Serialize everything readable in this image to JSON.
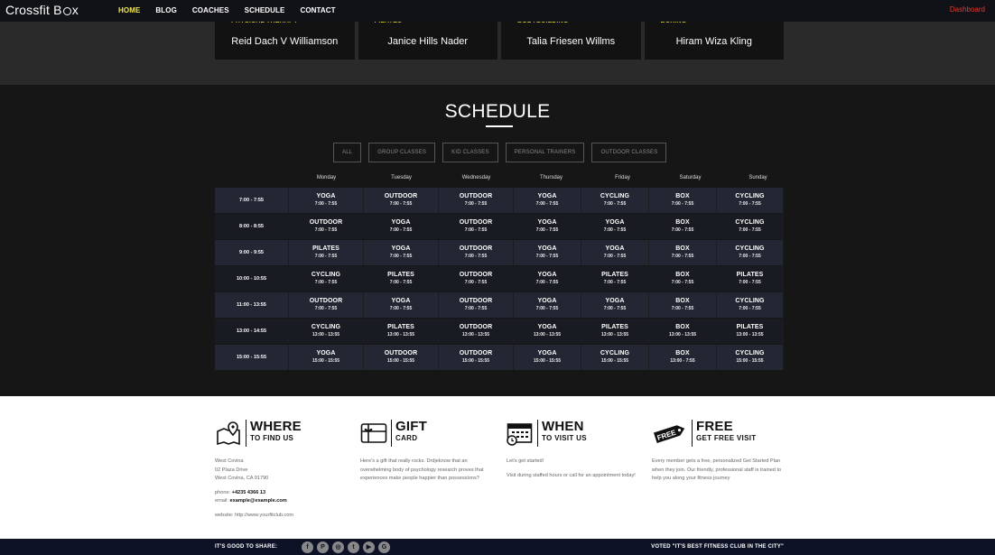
{
  "nav": {
    "logo": "Crossfit B",
    "logo_end": "x",
    "links": [
      "HOME",
      "BLOG",
      "COACHES",
      "SCHEDULE",
      "CONTACT"
    ],
    "dashboard": "Dashboard"
  },
  "coaches": [
    {
      "role": "PHYSICAL THERAPY",
      "name": "Reid Dach V Williamson"
    },
    {
      "role": "PILATES",
      "name": "Janice Hills Nader"
    },
    {
      "role": "BODYBUILDING",
      "name": "Talia Friesen Willms"
    },
    {
      "role": "BOXING",
      "name": "Hiram Wiza Kling"
    }
  ],
  "schedule": {
    "title": "SCHEDULE",
    "filters": [
      "ALL",
      "GROUP CLASSES",
      "KID CLASSES",
      "PERSONAL TRAINERS",
      "OUTDOOR CLASSES"
    ],
    "days": [
      "Monday",
      "Tuesday",
      "Wednesday",
      "Thursday",
      "Friday",
      "Saturday",
      "Sunday"
    ],
    "rows": [
      {
        "time": "7:00 - 7:55",
        "slots": [
          {
            "cls": "YOGA",
            "tm": "7:00 - 7:55"
          },
          {
            "cls": "OUTDOOR",
            "tm": "7:00 - 7:55"
          },
          {
            "cls": "OUTDOOR",
            "tm": "7:00 - 7:55"
          },
          {
            "cls": "YOGA",
            "tm": "7:00 - 7:55"
          },
          {
            "cls": "CYCLING",
            "tm": "7:00 - 7:55"
          },
          {
            "cls": "BOX",
            "tm": "7:00 - 7:55"
          },
          {
            "cls": "CYCLING",
            "tm": "7:00 - 7:55"
          }
        ]
      },
      {
        "time": "8:00 - 8:55",
        "slots": [
          {
            "cls": "OUTDOOR",
            "tm": "7:00 - 7:55"
          },
          {
            "cls": "YOGA",
            "tm": "7:00 - 7:55"
          },
          {
            "cls": "OUTDOOR",
            "tm": "7:00 - 7:55"
          },
          {
            "cls": "YOGA",
            "tm": "7:00 - 7:55"
          },
          {
            "cls": "YOGA",
            "tm": "7:00 - 7:55"
          },
          {
            "cls": "BOX",
            "tm": "7:00 - 7:55"
          },
          {
            "cls": "CYCLING",
            "tm": "7:00 - 7:55"
          }
        ]
      },
      {
        "time": "9:00 - 9:55",
        "slots": [
          {
            "cls": "PILATES",
            "tm": "7:00 - 7:55"
          },
          {
            "cls": "YOGA",
            "tm": "7:00 - 7:55"
          },
          {
            "cls": "OUTDOOR",
            "tm": "7:00 - 7:55"
          },
          {
            "cls": "YOGA",
            "tm": "7:00 - 7:55"
          },
          {
            "cls": "YOGA",
            "tm": "7:00 - 7:55"
          },
          {
            "cls": "BOX",
            "tm": "7:00 - 7:55"
          },
          {
            "cls": "CYCLING",
            "tm": "7:00 - 7:55"
          }
        ]
      },
      {
        "time": "10:00 - 10:55",
        "slots": [
          {
            "cls": "CYCLING",
            "tm": "7:00 - 7:55"
          },
          {
            "cls": "PILATES",
            "tm": "7:00 - 7:55"
          },
          {
            "cls": "OUTDOOR",
            "tm": "7:00 - 7:55"
          },
          {
            "cls": "YOGA",
            "tm": "7:00 - 7:55"
          },
          {
            "cls": "PILATES",
            "tm": "7:00 - 7:55"
          },
          {
            "cls": "BOX",
            "tm": "7:00 - 7:55"
          },
          {
            "cls": "PILATES",
            "tm": "7:00 - 7:55"
          }
        ]
      },
      {
        "time": "11:00 - 13:55",
        "slots": [
          {
            "cls": "OUTDOOR",
            "tm": "7:00 - 7:55"
          },
          {
            "cls": "YOGA",
            "tm": "7:00 - 7:55"
          },
          {
            "cls": "OUTDOOR",
            "tm": "7:00 - 7:55"
          },
          {
            "cls": "YOGA",
            "tm": "7:00 - 7:55"
          },
          {
            "cls": "YOGA",
            "tm": "7:00 - 7:55"
          },
          {
            "cls": "BOX",
            "tm": "7:00 - 7:55"
          },
          {
            "cls": "CYCLING",
            "tm": "7:00 - 7:55"
          }
        ]
      },
      {
        "time": "13:00 - 14:55",
        "slots": [
          {
            "cls": "CYCLING",
            "tm": "13:00 - 13:55"
          },
          {
            "cls": "PILATES",
            "tm": "13:00 - 13:55"
          },
          {
            "cls": "OUTDOOR",
            "tm": "13:00 - 13:55"
          },
          {
            "cls": "YOGA",
            "tm": "13:00 - 13:55"
          },
          {
            "cls": "PILATES",
            "tm": "13:00 - 13:55"
          },
          {
            "cls": "BOX",
            "tm": "13:00 - 13:55"
          },
          {
            "cls": "PILATES",
            "tm": "13:00 - 13:55"
          }
        ]
      },
      {
        "time": "15:00 - 15:55",
        "slots": [
          {
            "cls": "YOGA",
            "tm": "15:00 - 15:55"
          },
          {
            "cls": "OUTDOOR",
            "tm": "15:00 - 15:55"
          },
          {
            "cls": "OUTDOOR",
            "tm": "15:00 - 15:55"
          },
          {
            "cls": "YOGA",
            "tm": "15:00 - 15:55"
          },
          {
            "cls": "CYCLING",
            "tm": "15:00 - 15:55"
          },
          {
            "cls": "BOX",
            "tm": "13:00 - 7:55"
          },
          {
            "cls": "CYCLING",
            "tm": "15:00 - 15:55"
          }
        ]
      }
    ]
  },
  "info": {
    "where": {
      "title": "WHERE",
      "sub": "TO FIND US",
      "l1": "West Covina",
      "l2": "02 Plaza Drive",
      "l3": "West Covina, CA 91790",
      "phone_label": "phone:",
      "phone": "+4235 4366 13",
      "email_label": "email:",
      "email": "example@example.com",
      "website": "website: http://www.yourfitclub.com"
    },
    "gift": {
      "title": "GIFT",
      "sub": "CARD",
      "text": "Here's a gift that really rocks. Drdjeknow that an overwhelming body of psychology research proves that experiences make people happier than possessions?"
    },
    "when": {
      "title": "WHEN",
      "sub": "TO VISIT US",
      "t1": "Let's get started!",
      "t2": "Visit during staffed hours or call for an appointment today!"
    },
    "free": {
      "title": "FREE",
      "sub": "GET FREE VISIT",
      "badge": "FREE",
      "text": "Every member gets a free, personalized Get Started Plan when they join. Our friendly, professional staff is trained to help you along your fitness journey"
    }
  },
  "footer": {
    "share": "IT'S GOOD TO SHARE:",
    "socials": [
      "f",
      "P",
      "◎",
      "t",
      "▶",
      "G"
    ],
    "voted": "VOTED \"IT'S BEST FITNESS CLUB IN THE CITY\""
  },
  "colors": {
    "active_nav": "#f2e84b",
    "dashboard": "#e63b2e",
    "footer_bg": "#0d1227"
  }
}
